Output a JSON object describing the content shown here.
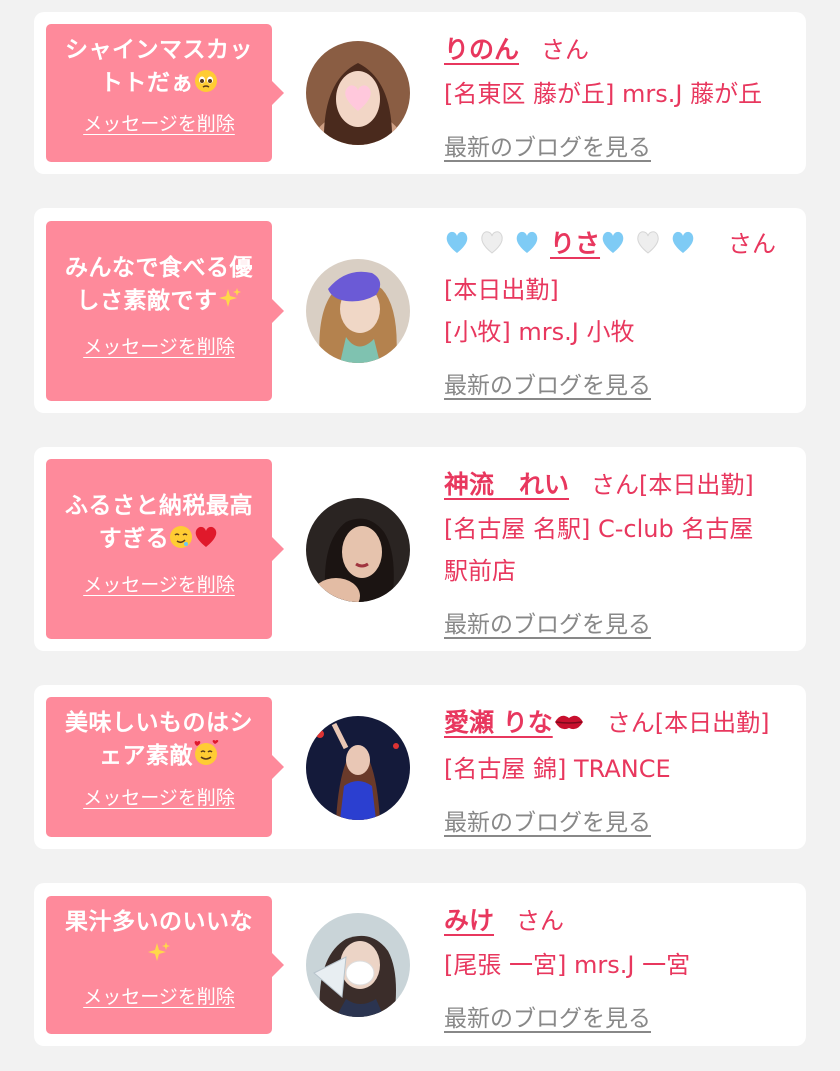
{
  "delete_label": "メッセージを削除",
  "blog_label": "最新のブログを見る",
  "san_label": "さん",
  "colors": {
    "accent": "#e8375e",
    "bubble": "#fe8a9b",
    "link_gray": "#888888",
    "background": "#f2f2f2"
  },
  "cards": [
    {
      "message_line1": "シャインマスカッ",
      "message_line2": "トだぁ",
      "message_icon": "pleading-face-icon",
      "name": "りのん",
      "san_suffix": "",
      "line1": "[名東区 藤が丘] mrs.J 藤が丘",
      "line2": "",
      "line3": ""
    },
    {
      "message_line1": "みんなで食べる優",
      "message_line2": "しさ素敵です",
      "message_icon": "sparkles-icon",
      "name": "りさ",
      "name_icons": "light-blue-hearts-icon",
      "san_suffix": "",
      "line1": "[本日出勤]",
      "line2": "[小牧] mrs.J 小牧",
      "line3": ""
    },
    {
      "message_line1": "ふるさと納税最高",
      "message_line2": "すぎる",
      "message_icon": "drooling-face-and-red-heart-icon",
      "name": "神流　れい",
      "san_suffix": "[本日出勤]",
      "line1": "[名古屋 名駅] C-club 名古屋",
      "line2": "駅前店",
      "line3": ""
    },
    {
      "message_line1": "美味しいものはシ",
      "message_line2": "ェア素敵",
      "message_icon": "smiling-face-with-hearts-icon",
      "name": "愛瀬 りな",
      "name_icons": "kiss-mark-icon",
      "san_suffix": "[本日出勤]",
      "line1": "[名古屋 錦] TRANCE",
      "line2": "",
      "line3": ""
    },
    {
      "message_line1": "果汁多いのいいな",
      "message_line2": "",
      "message_icon": "sparkles-icon",
      "name": "みけ",
      "san_suffix": "",
      "line1": "[尾張 一宮] mrs.J 一宮",
      "line2": "",
      "line3": ""
    }
  ]
}
